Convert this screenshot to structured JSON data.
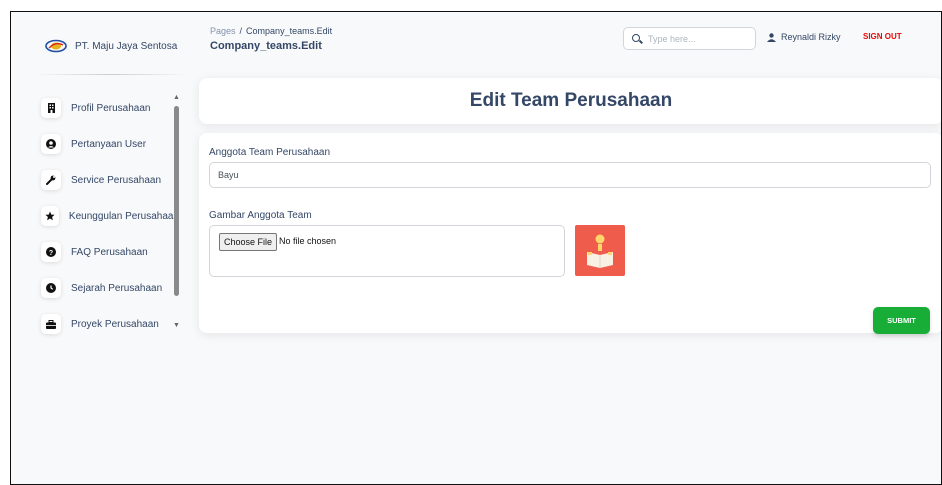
{
  "brand": {
    "name": "PT. Maju Jaya Sentosa"
  },
  "sidebar": {
    "items": [
      {
        "label": "Profil Perusahaan",
        "icon": "building-icon"
      },
      {
        "label": "Pertanyaan User",
        "icon": "user-circle-icon"
      },
      {
        "label": "Service Perusahaan",
        "icon": "wrench-icon"
      },
      {
        "label": "Keunggulan Perusahaan",
        "icon": "star-icon"
      },
      {
        "label": "FAQ Perusahaan",
        "icon": "question-circle-icon"
      },
      {
        "label": "Sejarah Perusahaan",
        "icon": "history-icon"
      },
      {
        "label": "Proyek Perusahaan",
        "icon": "briefcase-icon"
      }
    ]
  },
  "header": {
    "breadcrumb_root": "Pages",
    "breadcrumb_current": "Company_teams.Edit",
    "title": "Company_teams.Edit",
    "search_placeholder": "Type here...",
    "user_name": "Reynaldi Rizky",
    "signout_label": "SIGN OUT"
  },
  "main": {
    "card_title": "Edit Team Perusahaan",
    "form": {
      "name_label": "Anggota Team Perusahaan",
      "name_value": "Bayu",
      "image_label": "Gambar Anggota Team",
      "file_button": "Choose File",
      "file_status": "No file chosen",
      "submit_label": "SUBMIT"
    }
  },
  "colors": {
    "text_primary": "#344767",
    "signout": "#ea0606",
    "submit": "#17ad37",
    "thumbnail_bg": "#ef5c4b"
  }
}
